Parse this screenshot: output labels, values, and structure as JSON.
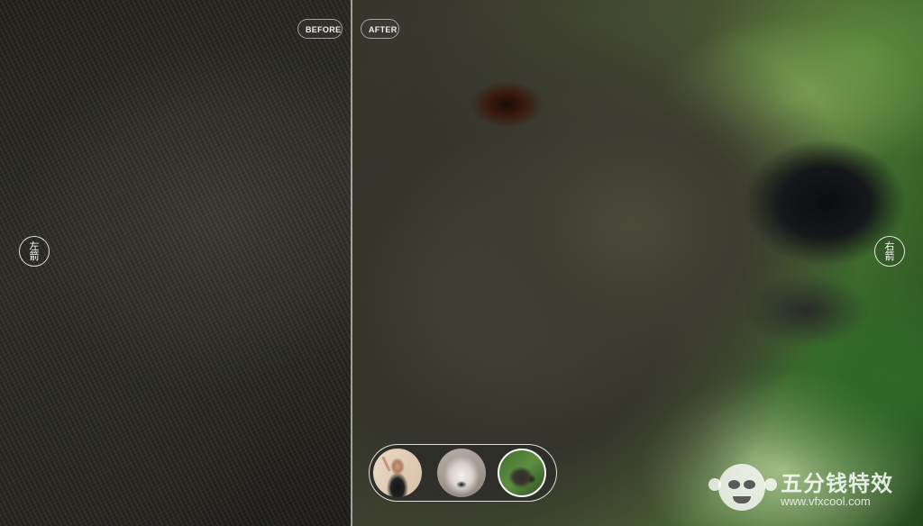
{
  "comparison": {
    "before_label": "BEFORE",
    "after_label": "AFTER",
    "divider_position": 0.38
  },
  "navigation": {
    "left_label": "左箭",
    "right_label": "右箭"
  },
  "thumbnails": {
    "items": [
      {
        "subject": "dancer",
        "selected": false
      },
      {
        "subject": "arctic-fox",
        "selected": false
      },
      {
        "subject": "bear",
        "selected": true
      }
    ]
  },
  "watermark": {
    "text": "五分钱特效",
    "url": "www.vfxcool.com"
  }
}
